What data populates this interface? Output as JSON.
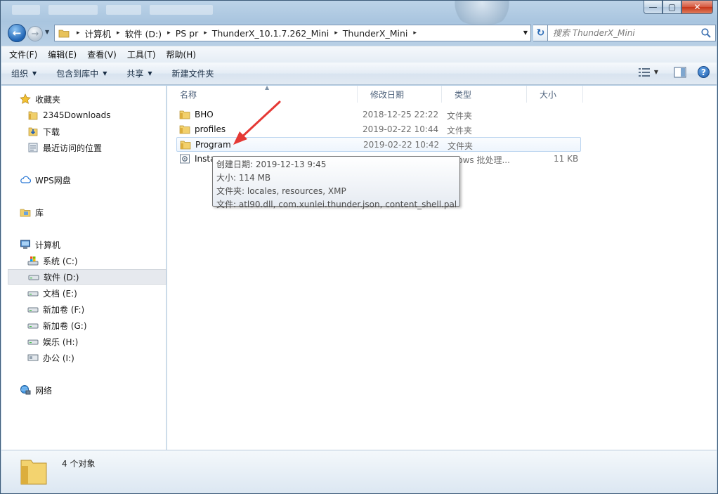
{
  "window": {
    "minimize_glyph": "—",
    "maximize_glyph": "▢",
    "close_glyph": "✕"
  },
  "nav": {
    "back_glyph": "←",
    "forward_glyph": "→",
    "breadcrumbs": [
      "计算机",
      "软件 (D:)",
      "PS pr",
      "ThunderX_10.1.7.262_Mini",
      "ThunderX_Mini"
    ],
    "crumb_separator": "▸",
    "refresh_glyph": "↻",
    "search_placeholder": "搜索 ThunderX_Mini"
  },
  "menu": [
    "文件(F)",
    "编辑(E)",
    "查看(V)",
    "工具(T)",
    "帮助(H)"
  ],
  "commands": {
    "organize": "组织",
    "include_library": "包含到库中",
    "share": "共享",
    "new_folder": "新建文件夹",
    "help": "?"
  },
  "sidebar": {
    "favorites": "收藏夹",
    "favorites_items": [
      "2345Downloads",
      "下载",
      "最近访问的位置"
    ],
    "wps": "WPS网盘",
    "libraries": "库",
    "computer": "计算机",
    "drives": [
      "系统 (C:)",
      "软件 (D:)",
      "文档 (E:)",
      "新加卷 (F:)",
      "新加卷 (G:)",
      "娱乐 (H:)",
      "办公 (I:)"
    ],
    "selected_drive_index": 1,
    "network": "网络"
  },
  "columns": {
    "name": "名称",
    "modified": "修改日期",
    "type": "类型",
    "size": "大小"
  },
  "files": [
    {
      "name": "BHO",
      "modified": "2018-12-25 22:22",
      "type": "文件夹",
      "size": "",
      "icon": "folder-icon"
    },
    {
      "name": "profiles",
      "modified": "2019-02-22 10:44",
      "type": "文件夹",
      "size": "",
      "icon": "folder-icon"
    },
    {
      "name": "Program",
      "modified": "2019-02-22 10:42",
      "type": "文件夹",
      "size": "",
      "icon": "folder-icon"
    },
    {
      "name": "Insta",
      "modified": "",
      "type": "ndows 批处理...",
      "size": "11 KB",
      "icon": "batch-file-icon"
    }
  ],
  "tooltip": {
    "created": "创建日期: 2019-12-13 9:45",
    "size": "大小: 114 MB",
    "folders": "文件夹: locales, resources, XMP",
    "files": "文件: atl90.dll, com.xunlei.thunder.json, content_shell.pak, ..."
  },
  "status": {
    "count": "4 个对象"
  },
  "colors": {
    "accent": "#3399ff",
    "annotation_arrow": "#e53935"
  }
}
